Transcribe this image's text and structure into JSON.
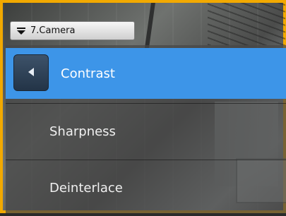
{
  "camera_selector": {
    "label": "7.Camera",
    "icon": "dropdown-icon"
  },
  "menu": {
    "back_icon": "chevron-left-icon",
    "items": [
      {
        "label": "Contrast",
        "selected": true
      },
      {
        "label": "Sharpness",
        "selected": false
      },
      {
        "label": "Deinterlace",
        "selected": false
      }
    ]
  },
  "colors": {
    "frame_border": "#f2a900",
    "selected_item": "#3d95e8",
    "back_button": "#2c3f55"
  }
}
